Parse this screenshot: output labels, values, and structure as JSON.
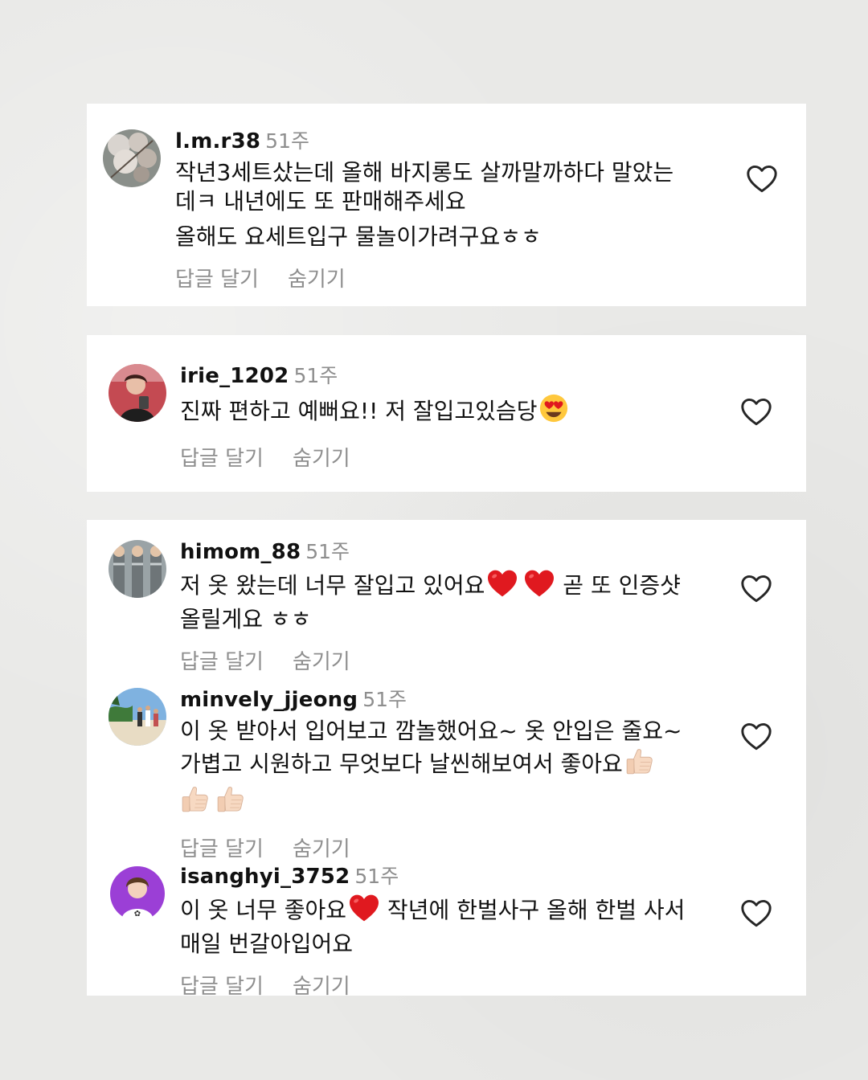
{
  "colors": {
    "background": "#e9e9e7",
    "card": "#ffffff",
    "username": "#111111",
    "muted": "#8e8e8e",
    "heart_red": "#e0191f"
  },
  "comments": [
    {
      "username": "l.m.r38",
      "time": "51주",
      "lines": [
        "작년3세트샀는데 올해 바지롱도 살까말까하다 말았는",
        "데ㅋ 내년에도 또 판매해주세요"
      ],
      "extra": "올해도 요세트입구 물놀이가려구요ㅎㅎ",
      "reply": "답글 달기",
      "hide": "숨기기",
      "icon": "heart-outline-icon"
    },
    {
      "username": "irie_1202",
      "time": "51주",
      "lines": [
        "진짜 편하고 예뻐요!! 저 잘입고있슴당"
      ],
      "emoji_after": "heart-eyes-emoji",
      "reply": "답글 달기",
      "hide": "숨기기",
      "icon": "heart-outline-icon"
    },
    {
      "username": "himom_88",
      "time": "51주",
      "line1a": "저 옷 왔는데 너무 잘입고 있어요",
      "line1b": " 곧 또 인증샷",
      "line2": "올릴게요 ㅎㅎ",
      "reply": "답글 달기",
      "hide": "숨기기",
      "icon": "heart-outline-icon"
    },
    {
      "username": "minvely_jjeong",
      "time": "51주",
      "line1": "이 옷 받아서 입어보고 깜놀했어요~ 옷 안입은 줄요~",
      "line2": "가볍고 시원하고 무엇보다 날씬해보여서 좋아요",
      "reply": "답글 달기",
      "hide": "숨기기",
      "icon": "heart-outline-icon"
    },
    {
      "username": "isanghyi_3752",
      "time": "51주",
      "line1a": "이 옷 너무 좋아요",
      "line1b": " 작년에 한벌사구 올해 한벌 사서",
      "line2": "매일 번갈아입어요",
      "reply": "답글 달기",
      "hide": "숨기기",
      "icon": "heart-outline-icon"
    }
  ]
}
